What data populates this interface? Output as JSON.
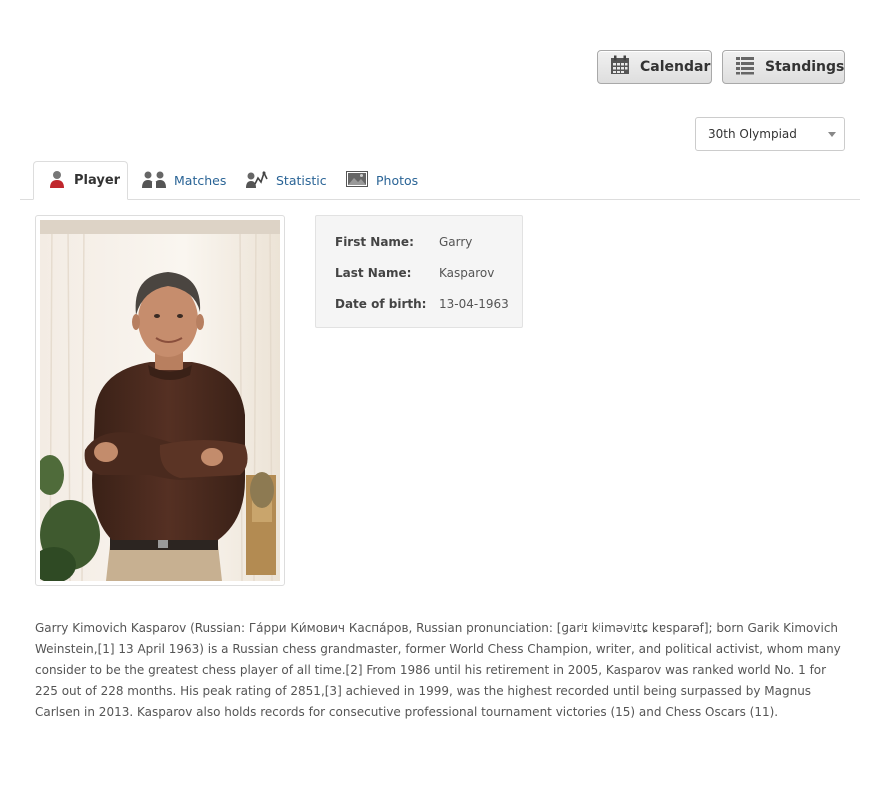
{
  "toolbar": {
    "calendar_label": "Calendar",
    "standings_label": "Standings"
  },
  "event_select": {
    "selected": "30th Olympiad"
  },
  "tabs": [
    {
      "label": "Player",
      "icon": "player-icon",
      "active": true
    },
    {
      "label": "Matches",
      "icon": "matches-icon",
      "active": false
    },
    {
      "label": "Statistic",
      "icon": "statistic-icon",
      "active": false
    },
    {
      "label": "Photos",
      "icon": "photos-icon",
      "active": false
    }
  ],
  "player": {
    "first_name_label": "First Name:",
    "first_name": "Garry",
    "last_name_label": "Last Name:",
    "last_name": "Kasparov",
    "dob_label": "Date of birth:",
    "dob": "13-04-1963"
  },
  "bio": "Garry Kimovich Kasparov (Russian: Га́рри Ки́мович Каспа́ров, Russian pronunciation: [ɡarʲɪ kʲiməvʲɪtɕ kɐsparəf]; born Garik Kimovich Weinstein,[1] 13 April 1963) is a Russian chess grandmaster, former World Chess Champion, writer, and political activist, whom many consider to be the greatest chess player of all time.[2] From 1986 until his retirement in 2005, Kasparov was ranked world No. 1 for 225 out of 228 months. His peak rating of 2851,[3] achieved in 1999, was the highest recorded until being surpassed by Magnus Carlsen in 2013. Kasparov also holds records for consecutive professional tournament victories (15) and Chess Oscars (11).",
  "colors": {
    "link": "#2a6496",
    "player_icon": "#c0272d",
    "button_bg": "#e6e6e6"
  }
}
